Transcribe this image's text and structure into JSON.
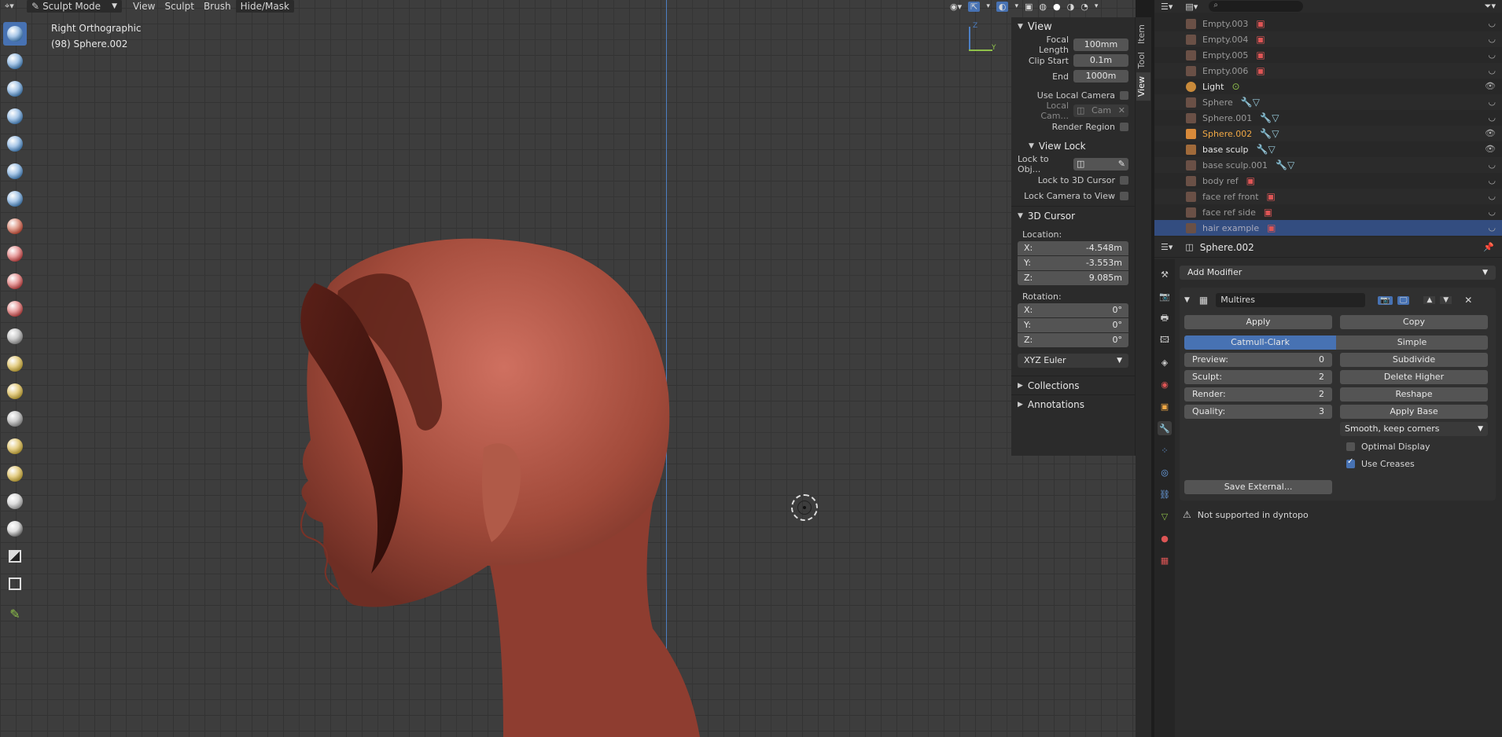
{
  "header": {
    "mode": "Sculpt Mode",
    "menus": [
      "View",
      "Sculpt",
      "Brush",
      "Hide/Mask"
    ]
  },
  "viewport": {
    "view_name": "Right Orthographic",
    "object_info": "(98) Sphere.002",
    "axis_z": "Z",
    "axis_y": "Y"
  },
  "npanel": {
    "tabs": [
      "Item",
      "Tool",
      "View"
    ],
    "view_title": "View",
    "focal_length_label": "Focal Length",
    "focal_length": "100mm",
    "clip_start_label": "Clip Start",
    "clip_start": "0.1m",
    "end_label": "End",
    "end": "1000m",
    "use_local_camera": "Use Local Camera",
    "local_cam_label": "Local Cam...",
    "local_cam_value": "Cam",
    "render_region": "Render Region",
    "view_lock_title": "View Lock",
    "lock_to_obj": "Lock to Obj...",
    "lock_to_3d_cursor": "Lock to 3D Cursor",
    "lock_camera_to_view": "Lock Camera to View",
    "cursor_title": "3D Cursor",
    "location_label": "Location:",
    "loc": [
      {
        "axis": "X:",
        "value": "-4.548m"
      },
      {
        "axis": "Y:",
        "value": "-3.553m"
      },
      {
        "axis": "Z:",
        "value": "9.085m"
      }
    ],
    "rotation_label": "Rotation:",
    "rot": [
      {
        "axis": "X:",
        "value": "0°"
      },
      {
        "axis": "Y:",
        "value": "0°"
      },
      {
        "axis": "Z:",
        "value": "0°"
      }
    ],
    "rotation_mode": "XYZ Euler",
    "collections": "Collections",
    "annotations": "Annotations"
  },
  "outliner": {
    "items": [
      {
        "name": "Empty.003",
        "style": "dim",
        "eye": ""
      },
      {
        "name": "Empty.004",
        "style": "dim",
        "eye": ""
      },
      {
        "name": "Empty.005",
        "style": "dim",
        "eye": ""
      },
      {
        "name": "Empty.006",
        "style": "dim",
        "eye": ""
      },
      {
        "name": "Light",
        "style": "white",
        "eye": "open"
      },
      {
        "name": "Sphere",
        "style": "dim",
        "eye": ""
      },
      {
        "name": "Sphere.001",
        "style": "dim",
        "eye": ""
      },
      {
        "name": "Sphere.002",
        "style": "active",
        "eye": "open"
      },
      {
        "name": "base sculp",
        "style": "white",
        "eye": "open"
      },
      {
        "name": "base sculp.001",
        "style": "dim",
        "eye": ""
      },
      {
        "name": "body ref",
        "style": "dim",
        "eye": ""
      },
      {
        "name": "face ref front",
        "style": "dim",
        "eye": ""
      },
      {
        "name": "face ref side",
        "style": "dim",
        "eye": ""
      },
      {
        "name": "hair example",
        "style": "selected",
        "eye": ""
      }
    ]
  },
  "properties": {
    "object_name": "Sphere.002",
    "add_modifier": "Add Modifier",
    "modifier_name": "Multires",
    "apply": "Apply",
    "copy": "Copy",
    "catmull_clark": "Catmull-Clark",
    "simple": "Simple",
    "preview_label": "Preview:",
    "preview_value": "0",
    "sculpt_label": "Sculpt:",
    "sculpt_value": "2",
    "render_label": "Render:",
    "render_value": "2",
    "quality_label": "Quality:",
    "quality_value": "3",
    "subdivide": "Subdivide",
    "delete_higher": "Delete Higher",
    "reshape": "Reshape",
    "apply_base": "Apply Base",
    "uv_smooth": "Smooth, keep corners",
    "optimal_display": "Optimal Display",
    "use_creases": "Use Creases",
    "save_external": "Save External...",
    "warning": "Not supported in dyntopo"
  }
}
